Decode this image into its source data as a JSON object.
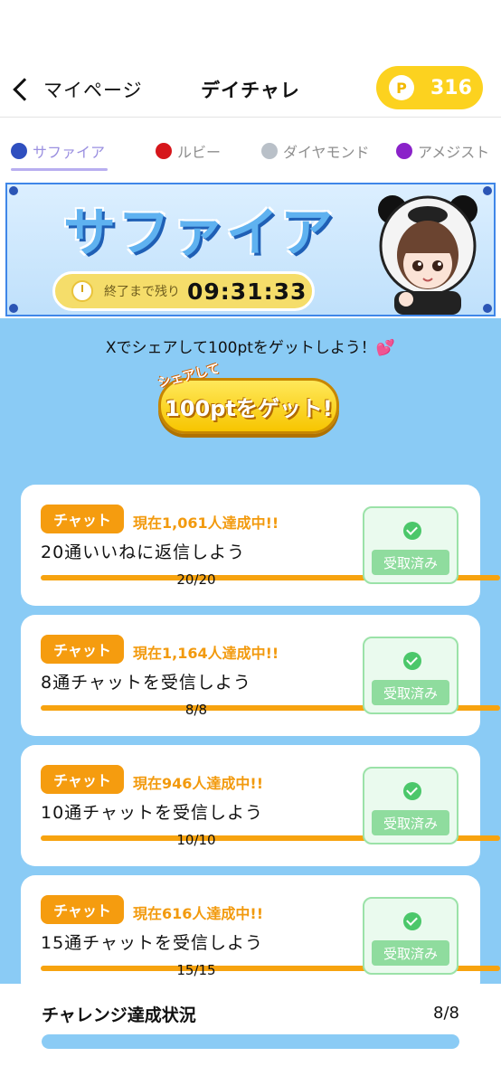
{
  "header": {
    "back_label": "マイページ",
    "title": "デイチャレ",
    "coin_symbol": "P",
    "points": "316"
  },
  "tabs": [
    {
      "label": "サファイア",
      "gem_color": "#2f4fbf",
      "active": true
    },
    {
      "label": "ルビー",
      "gem_color": "#d6161b",
      "active": false
    },
    {
      "label": "ダイヤモンド",
      "gem_color": "#b9c0c8",
      "active": false
    },
    {
      "label": "アメジスト",
      "gem_color": "#8a22c9",
      "active": false
    }
  ],
  "banner": {
    "title": "サファイア",
    "timer_label": "終了まで残り",
    "timer_value": "09:31:33"
  },
  "share": {
    "text": "Xでシェアして100ptをゲットしよう！💕",
    "button_small": "シェアして",
    "button_big": "100ptをゲット!"
  },
  "challenges": [
    {
      "tag": "チャット",
      "achieved": "現在1,061人達成中!!",
      "task": "20通いいねに返信しよう",
      "progress": "20/20",
      "fraction": 1.0,
      "status": "受取済み"
    },
    {
      "tag": "チャット",
      "achieved": "現在1,164人達成中!!",
      "task": "8通チャットを受信しよう",
      "progress": "8/8",
      "fraction": 1.0,
      "status": "受取済み"
    },
    {
      "tag": "チャット",
      "achieved": "現在946人達成中!!",
      "task": "10通チャットを受信しよう",
      "progress": "10/10",
      "fraction": 1.0,
      "status": "受取済み"
    },
    {
      "tag": "チャット",
      "achieved": "現在616人達成中!!",
      "task": "15通チャットを受信しよう",
      "progress": "15/15",
      "fraction": 1.0,
      "status": "受取済み"
    }
  ],
  "footer": {
    "label": "チャレンジ達成状況",
    "count": "8/8",
    "fraction": 1.0
  }
}
